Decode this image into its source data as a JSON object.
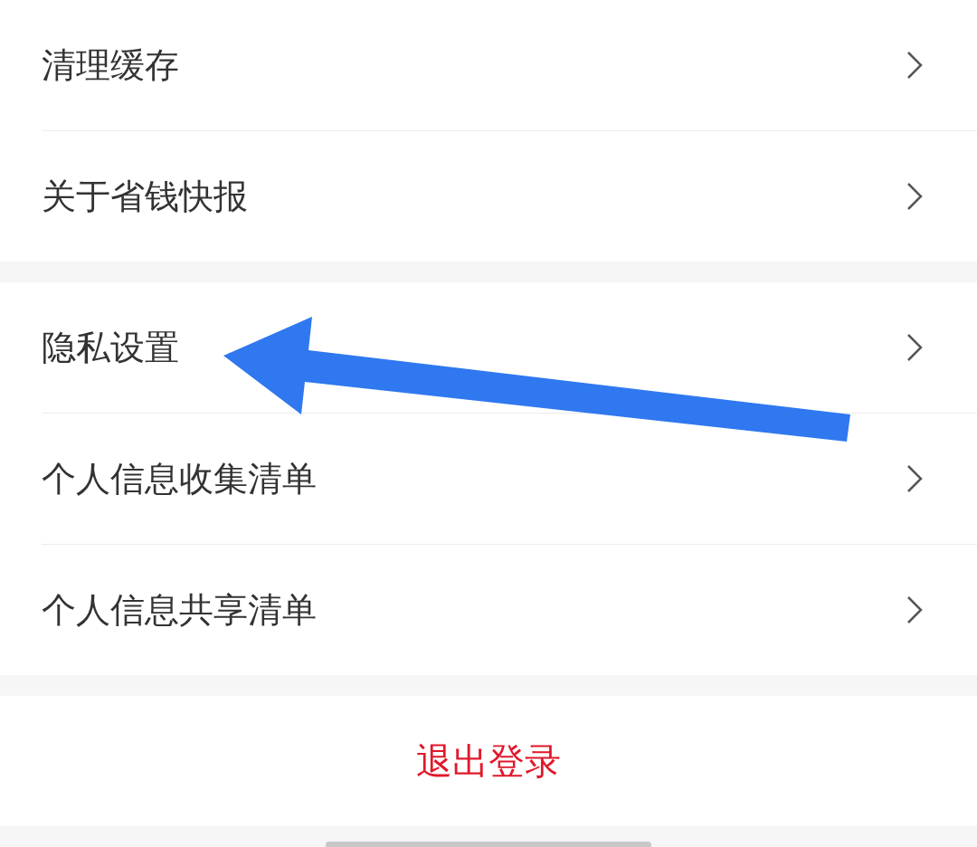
{
  "sections": [
    {
      "items": [
        {
          "label": "清理缓存"
        },
        {
          "label": "关于省钱快报"
        }
      ]
    },
    {
      "items": [
        {
          "label": "隐私设置"
        },
        {
          "label": "个人信息收集清单"
        },
        {
          "label": "个人信息共享清单"
        }
      ]
    }
  ],
  "logout_button": "退出登录"
}
